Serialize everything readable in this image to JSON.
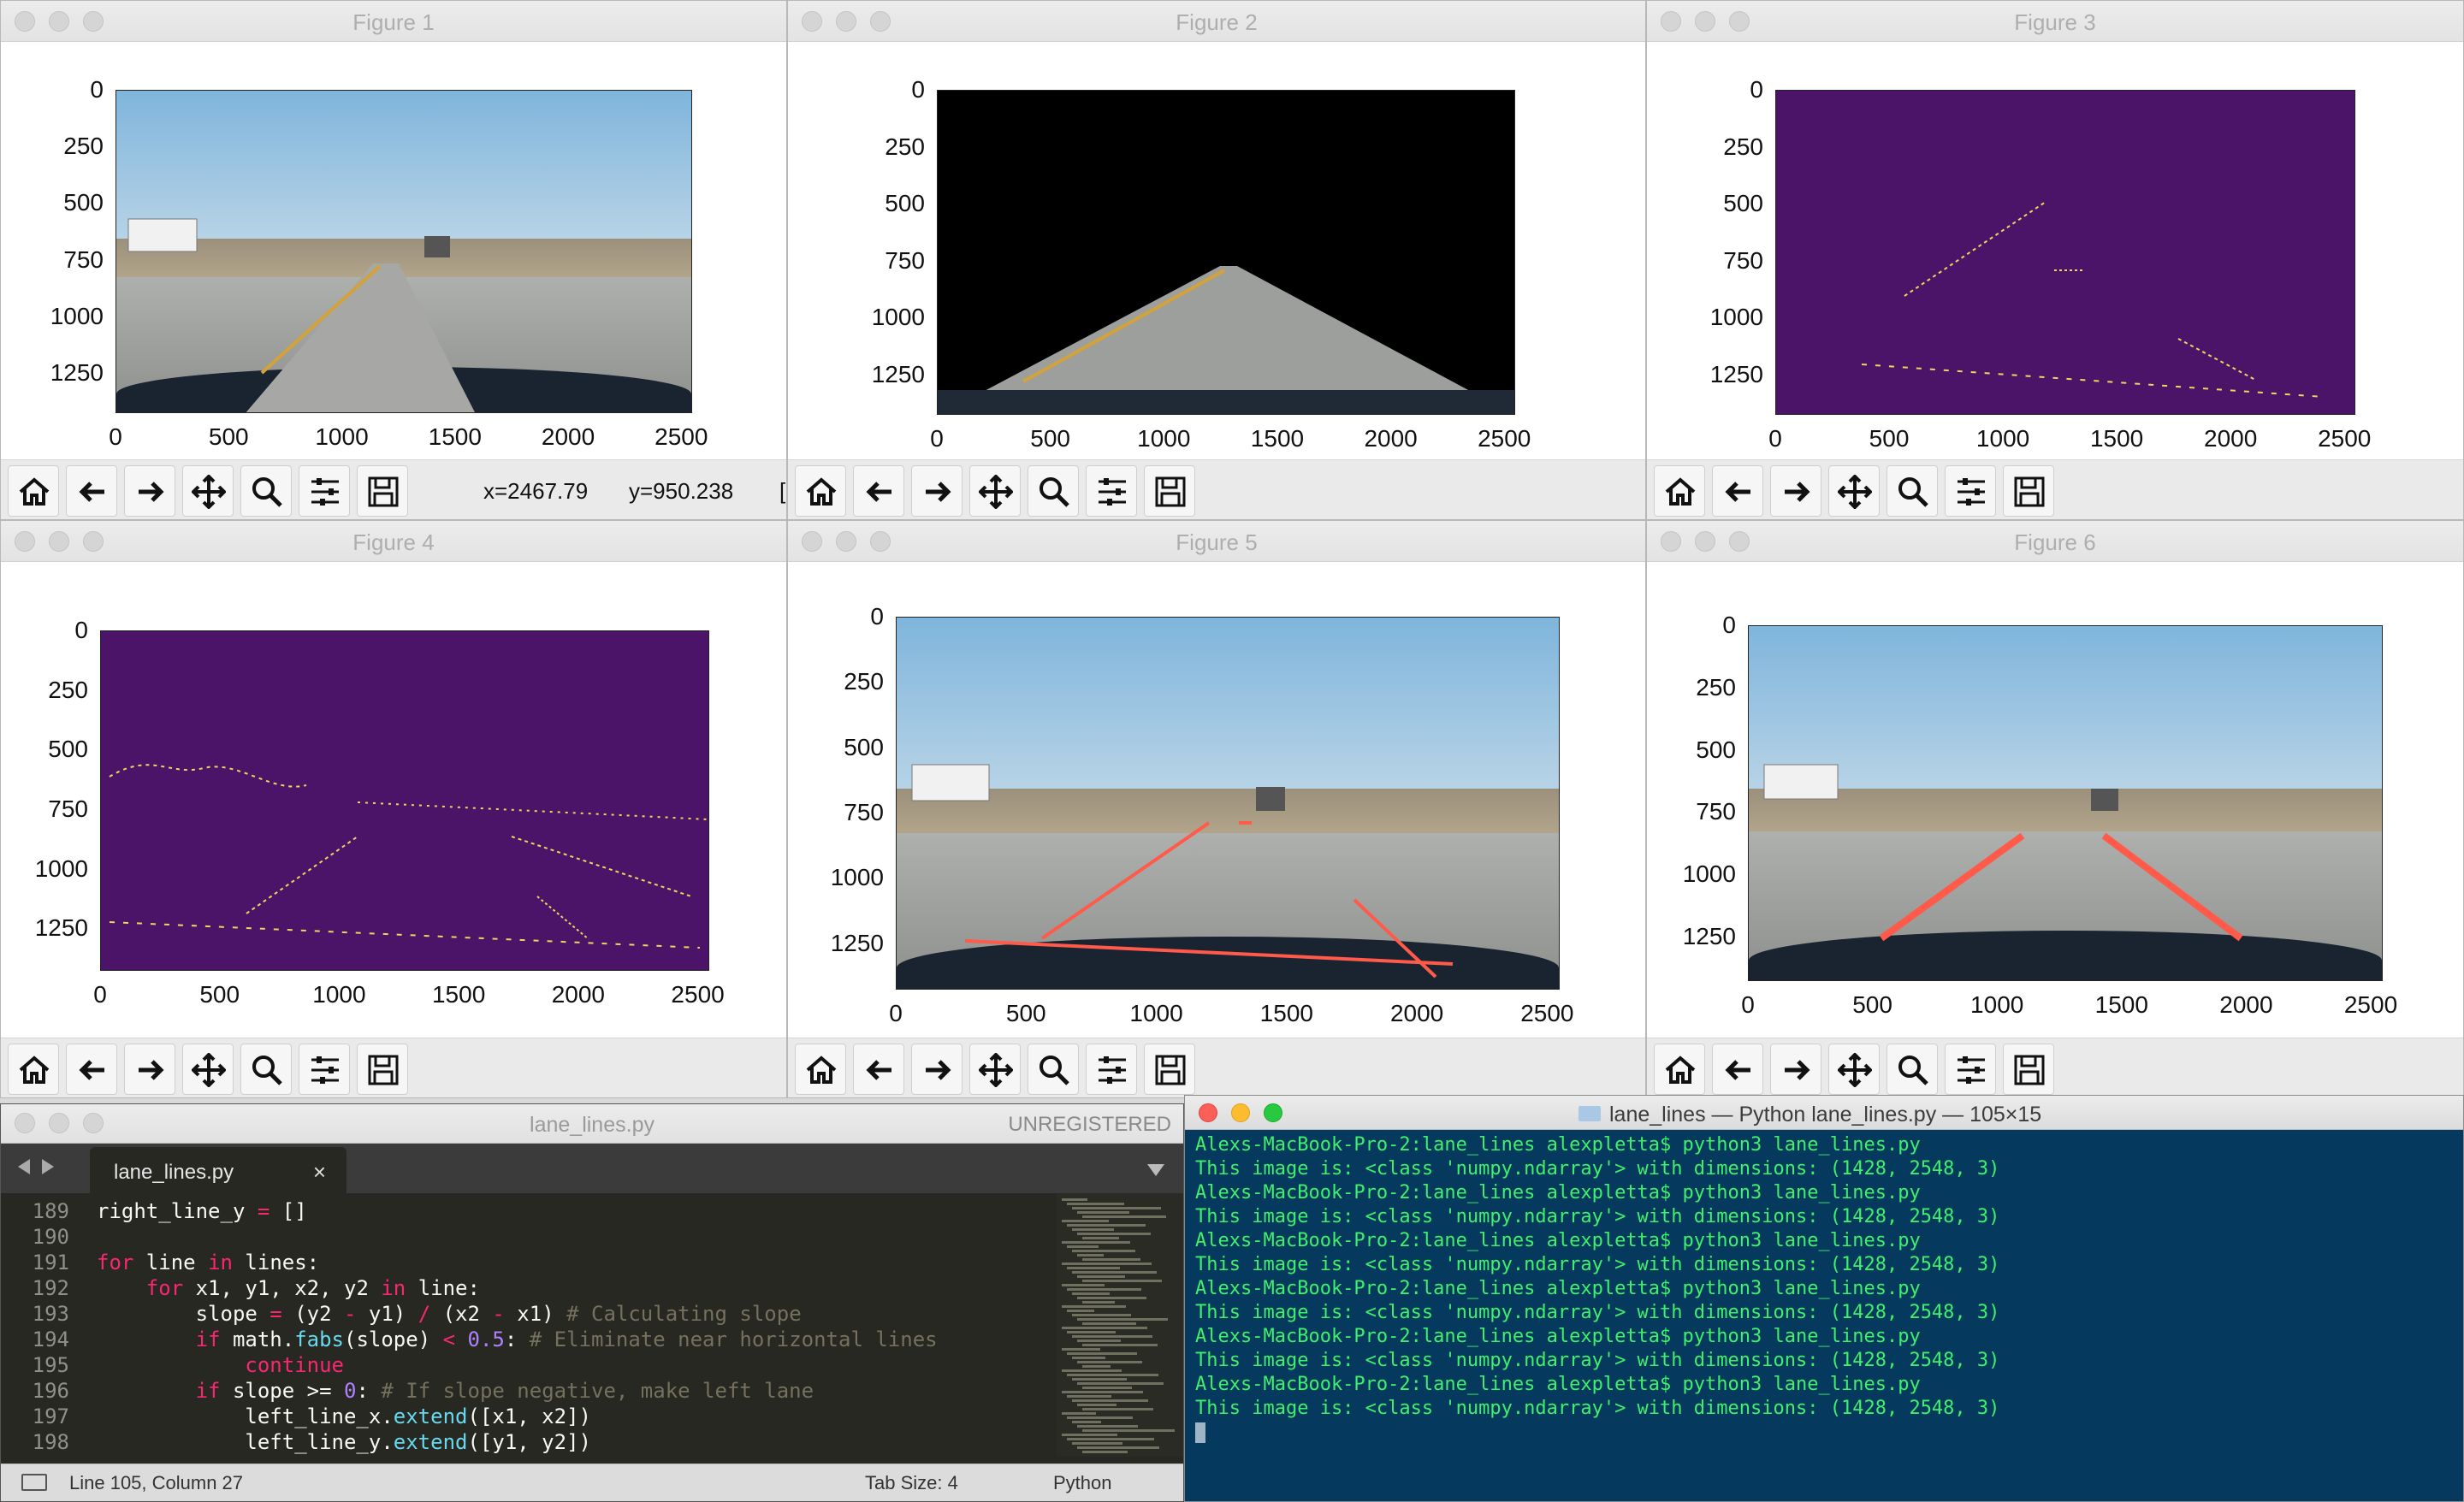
{
  "figures": [
    {
      "title": "Figure 1",
      "kind": "road",
      "coords_x": "x=2467.79",
      "coords_y": "y=950.238",
      "coords_extra": "["
    },
    {
      "title": "Figure 2",
      "kind": "masked"
    },
    {
      "title": "Figure 3",
      "kind": "edges_roi"
    },
    {
      "title": "Figure 4",
      "kind": "edges_full"
    },
    {
      "title": "Figure 5",
      "kind": "hough"
    },
    {
      "title": "Figure 6",
      "kind": "lanes"
    }
  ],
  "axes": {
    "y_ticks": [
      "0",
      "250",
      "500",
      "750",
      "1000",
      "1250"
    ],
    "x_ticks": [
      "0",
      "500",
      "1000",
      "1500",
      "2000",
      "2500"
    ]
  },
  "toolbar_icons": [
    "home-icon",
    "back-arrow-icon",
    "forward-arrow-icon",
    "pan-move-icon",
    "zoom-magnifier-icon",
    "configure-subplots-icon",
    "save-disk-icon"
  ],
  "editor": {
    "title": "lane_lines.py",
    "unregistered": "UNREGISTERED",
    "tab_label": "lane_lines.py",
    "tab_close": "×",
    "status_position": "Line 105, Column 27",
    "status_tab_size": "Tab Size: 4",
    "status_syntax": "Python",
    "lines": [
      {
        "n": "189",
        "code": "right_line_y = []"
      },
      {
        "n": "190",
        "code": ""
      },
      {
        "n": "191",
        "code": "for line in lines:"
      },
      {
        "n": "192",
        "code": "    for x1, y1, x2, y2 in line:"
      },
      {
        "n": "193",
        "code": "        slope = (y2 - y1) / (x2 - x1) # Calculating slope"
      },
      {
        "n": "194",
        "code": "        if math.fabs(slope) < 0.5: # Eliminate near horizontal lines"
      },
      {
        "n": "195",
        "code": "            continue"
      },
      {
        "n": "196",
        "code": "        if slope >= 0: # If slope negative, make left lane"
      },
      {
        "n": "197",
        "code": "            left_line_x.extend([x1, x2])"
      },
      {
        "n": "198",
        "code": "            left_line_y.extend([y1, y2])"
      }
    ]
  },
  "terminal": {
    "title": "lane_lines — Python lane_lines.py — 105×15",
    "prompt_line": "Alexs-MacBook-Pro-2:lane_lines alexpletta$ python3 lane_lines.py",
    "output_line": "This image is: <class 'numpy.ndarray'> with dimensions: (1428, 2548, 3)",
    "repeat_count": 6
  },
  "colors": {
    "lane_red": "#ff5a4a",
    "edge_yellow": "#f3d55b",
    "purple_bg": "#4c1468",
    "terminal_bg": "#053a5e",
    "terminal_fg": "#3ff06a"
  }
}
